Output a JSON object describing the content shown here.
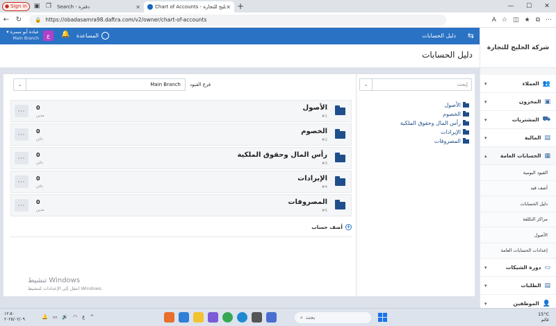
{
  "browser": {
    "signin_label": "Sign in",
    "tabs": [
      {
        "title": "Search - دفترة"
      },
      {
        "title": "Chart of Accounts - شركة الخليج للتجارة"
      }
    ],
    "url": "https://obadasamra98.daftra.com/v2/owner/chart-of-accounts"
  },
  "header": {
    "user_name": "عبادة أبو سمرة",
    "user_branch": "Main Branch",
    "avatar_letter": "ع",
    "help_label": "المساعدة",
    "breadcrumb": "دليل الحسابات"
  },
  "page_title": "دليل الحسابات",
  "sidebar": {
    "company": "شركة الخليج للتجارة",
    "items": [
      {
        "label": "العملاء",
        "icon": "users-icon"
      },
      {
        "label": "المخزون",
        "icon": "box-icon"
      },
      {
        "label": "المشتريات",
        "icon": "truck-icon"
      },
      {
        "label": "المالية",
        "icon": "wallet-icon"
      },
      {
        "label": "الحسابات العامة",
        "icon": "ledger-icon"
      }
    ],
    "subitems": [
      "القيود اليومية",
      "أضف قيد",
      "دليل الحسابات",
      "مراكز التكلفة",
      "الأصول",
      "إعدادات الحسابات العامة"
    ],
    "items_after": [
      {
        "label": "دورة الشيكات",
        "icon": "cheque-icon"
      },
      {
        "label": "الطلبات",
        "icon": "requests-icon"
      },
      {
        "label": "الموظفين",
        "icon": "employees-icon"
      }
    ]
  },
  "filter": {
    "branch_label": "فرع القيود",
    "branch_value": "Main Branch",
    "search_placeholder": "إبحث"
  },
  "accounts": [
    {
      "name": "الأصول",
      "code": "#1",
      "balance": "0",
      "type": "مدين"
    },
    {
      "name": "الخصوم",
      "code": "#2",
      "balance": "0",
      "type": "دائن"
    },
    {
      "name": "رأس المال وحقوق الملكية",
      "code": "#3",
      "balance": "0",
      "type": "دائن"
    },
    {
      "name": "الإيرادات",
      "code": "#4",
      "balance": "0",
      "type": "دائن"
    },
    {
      "name": "المصروفات",
      "code": "#5",
      "balance": "0",
      "type": "مدين"
    }
  ],
  "add_account_label": "أضف حساب",
  "tree": [
    "الأصول",
    "الخصوم",
    "رأس المال وحقوق الملكية",
    "الإيرادات",
    "المصروفات"
  ],
  "watermark": {
    "line1": "تنشيط Windows",
    "line2": "انتقل إلى الإعدادات لتنشيط Windows."
  },
  "taskbar": {
    "time": "١٢:٥٠",
    "date": "٢٠٢٥/٠٢/٠٩",
    "lang": "ع",
    "search_placeholder": "بحث",
    "temp": "15°C",
    "weather": "غائم"
  }
}
